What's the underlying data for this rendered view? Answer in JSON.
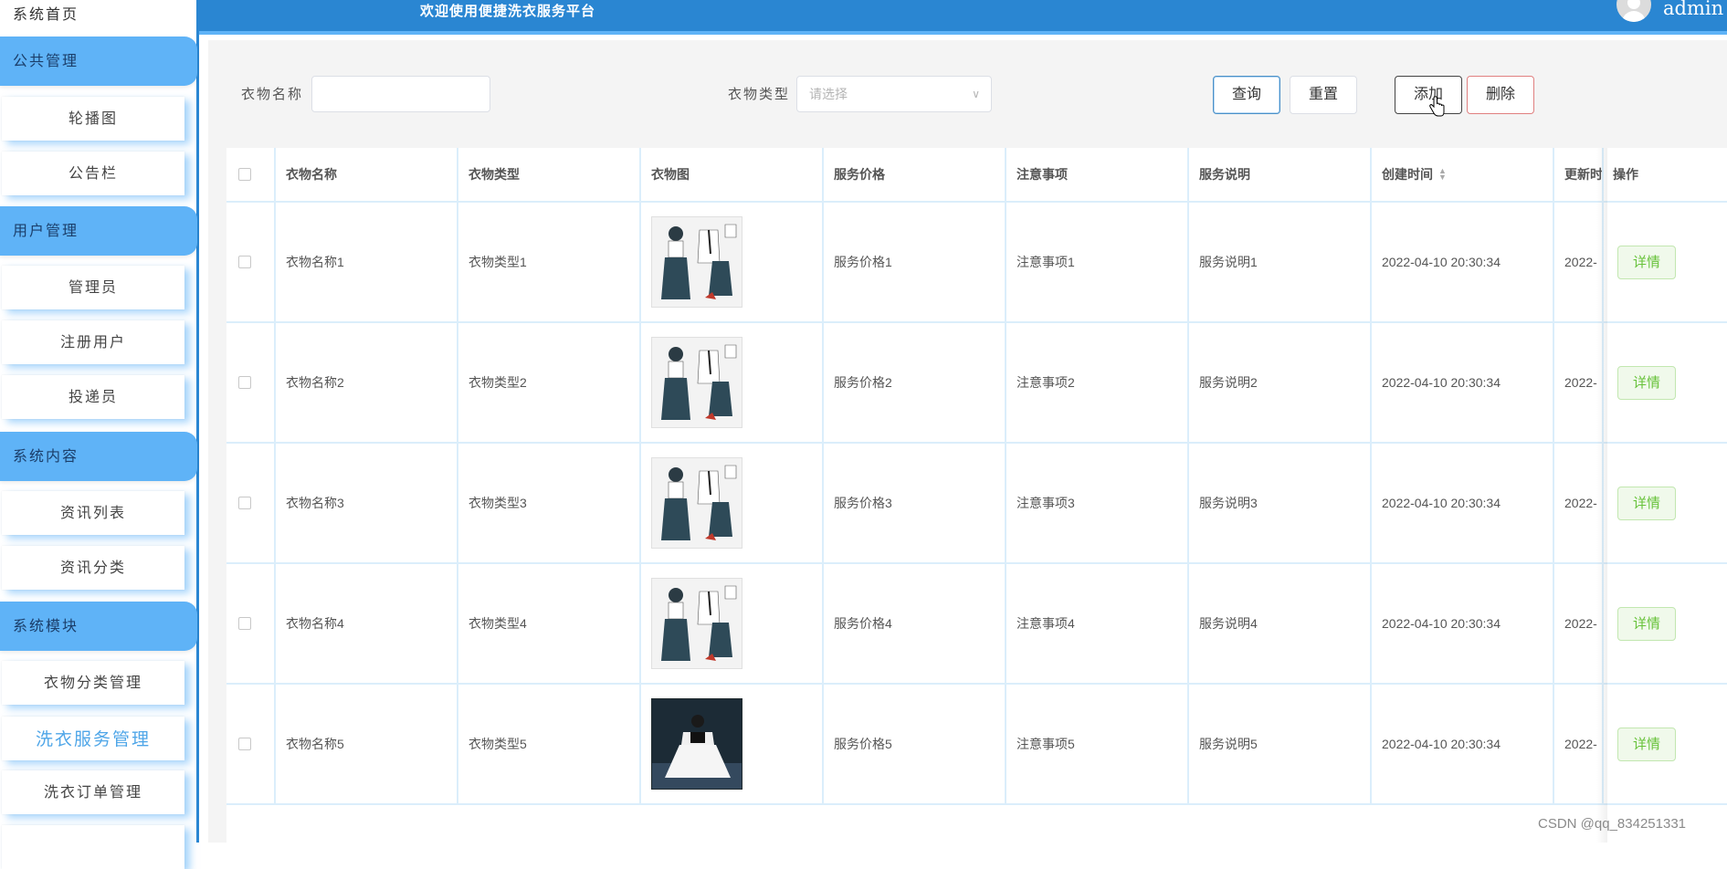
{
  "sidebar": {
    "home": "系统首页",
    "groups": [
      {
        "label": "公共管理",
        "items": [
          "轮播图",
          "公告栏"
        ]
      },
      {
        "label": "用户管理",
        "items": [
          "管理员",
          "注册用户",
          "投递员"
        ]
      },
      {
        "label": "系统内容",
        "items": [
          "资讯列表",
          "资讯分类"
        ]
      },
      {
        "label": "系统模块",
        "items": [
          "衣物分类管理",
          "洗衣服务管理",
          "洗衣订单管理"
        ]
      }
    ]
  },
  "header": {
    "welcome": "欢迎使用便捷洗衣服务平台",
    "username": "admin"
  },
  "search": {
    "name_label": "衣物名称",
    "name_value": "",
    "type_label": "衣物类型",
    "type_placeholder": "请选择",
    "query_label": "查询",
    "reset_label": "重置",
    "add_label": "添加",
    "delete_label": "删除"
  },
  "table": {
    "headers": [
      "衣物名称",
      "衣物类型",
      "衣物图",
      "服务价格",
      "注意事项",
      "服务说明",
      "创建时间",
      "更新时",
      "操作"
    ],
    "rows": [
      {
        "name": "衣物名称1",
        "type": "衣物类型1",
        "image": "clothing-sketch",
        "price": "服务价格1",
        "note": "注意事项1",
        "desc": "服务说明1",
        "created": "2022-04-10 20:30:34",
        "updated": "2022-",
        "action": "详情"
      },
      {
        "name": "衣物名称2",
        "type": "衣物类型2",
        "image": "clothing-sketch",
        "price": "服务价格2",
        "note": "注意事项2",
        "desc": "服务说明2",
        "created": "2022-04-10 20:30:34",
        "updated": "2022-",
        "action": "详情"
      },
      {
        "name": "衣物名称3",
        "type": "衣物类型3",
        "image": "clothing-sketch",
        "price": "服务价格3",
        "note": "注意事项3",
        "desc": "服务说明3",
        "created": "2022-04-10 20:30:34",
        "updated": "2022-",
        "action": "详情"
      },
      {
        "name": "衣物名称4",
        "type": "衣物类型4",
        "image": "clothing-sketch",
        "price": "服务价格4",
        "note": "注意事项4",
        "desc": "服务说明4",
        "created": "2022-04-10 20:30:34",
        "updated": "2022-",
        "action": "详情"
      },
      {
        "name": "衣物名称5",
        "type": "衣物类型5",
        "image": "runway-photo",
        "price": "服务价格5",
        "note": "注意事项5",
        "desc": "服务说明5",
        "created": "2022-04-10 20:30:34",
        "updated": "2022-",
        "action": "详情"
      }
    ]
  },
  "watermark": "CSDN @qq_834251331",
  "colors": {
    "header": "#2a86d2",
    "sidebar_group": "#5fb3f7",
    "detail": "#67c23a"
  }
}
